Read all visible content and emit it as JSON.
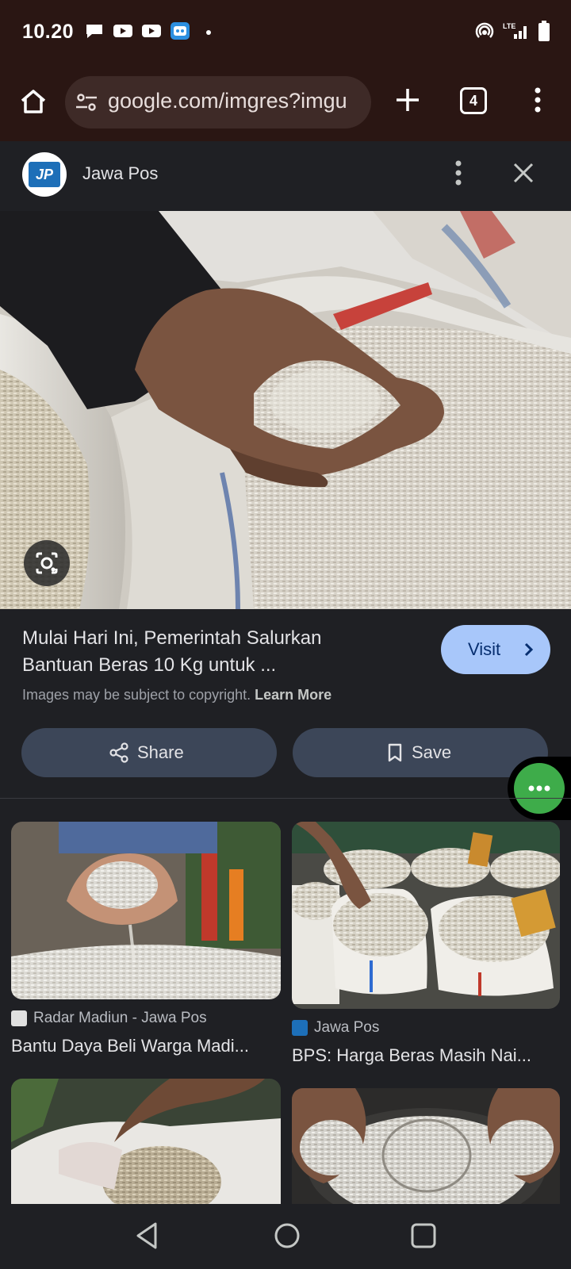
{
  "status_bar": {
    "time": "10.20",
    "network": "LTE"
  },
  "browser": {
    "url": "google.com/imgres?imgu",
    "tab_count": "4"
  },
  "source_header": {
    "logo_text": "JP",
    "name": "Jawa Pos"
  },
  "result": {
    "title_line1": "Mulai Hari Ini, Pemerintah Salurkan",
    "title_line2": "Bantuan Beras 10 Kg untuk ...",
    "visit_label": "Visit",
    "copyright_text": "Images may be subject to copyright.",
    "learn_more": "Learn More",
    "share_label": "Share",
    "save_label": "Save"
  },
  "related": [
    {
      "source": "Radar Madiun - Jawa Pos",
      "title": "Bantu Daya Beli Warga Madi..."
    },
    {
      "source": "Jawa Pos",
      "title": "BPS: Harga Beras Masih Nai..."
    }
  ],
  "colors": {
    "status_bg": "#2a1613",
    "page_bg": "#1f2024",
    "visit_bg": "#a8c7fa",
    "action_bg": "#3c4658",
    "bubble": "#3eac4a"
  }
}
